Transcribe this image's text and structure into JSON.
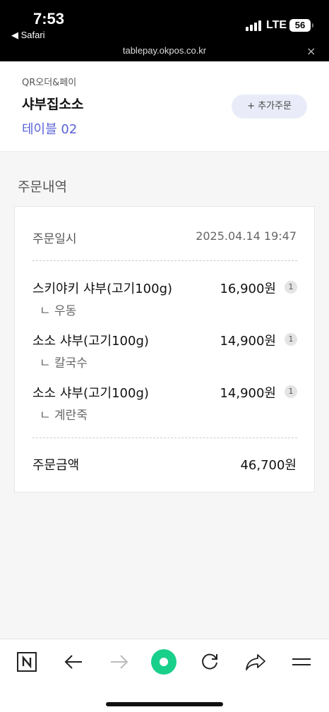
{
  "status_bar": {
    "time": "7:53",
    "back_app": "◀ Safari",
    "network": "LTE",
    "battery": "56"
  },
  "url_bar": {
    "url": "tablepay.okpos.co.kr",
    "close": "×"
  },
  "header": {
    "service_name": "QR오더&페이",
    "store_name": "샤부집소소",
    "table": "테이블 02",
    "add_order_label": "+ 추가주문"
  },
  "order": {
    "section_title": "주문내역",
    "date_label": "주문일시",
    "date_value": "2025.04.14 19:47",
    "items": [
      {
        "name": "스키야키 샤부(고기100g)",
        "option": "ㄴ 우동",
        "price": "16,900원",
        "qty": "1"
      },
      {
        "name": "소소 샤부(고기100g)",
        "option": "ㄴ 칼국수",
        "price": "14,900원",
        "qty": "1"
      },
      {
        "name": "소소 샤부(고기100g)",
        "option": "ㄴ 계란죽",
        "price": "14,900원",
        "qty": "1"
      }
    ],
    "total_label": "주문금액",
    "total_value": "46,700원"
  },
  "toolbar": {
    "icons": [
      "naver-icon",
      "back-arrow-icon",
      "forward-arrow-icon",
      "green-dot-icon",
      "refresh-icon",
      "share-icon",
      "menu-icon"
    ]
  },
  "colors": {
    "accent": "#5a63d8",
    "green_button": "#19d08a",
    "add_order_bg": "#e9ecf8"
  }
}
